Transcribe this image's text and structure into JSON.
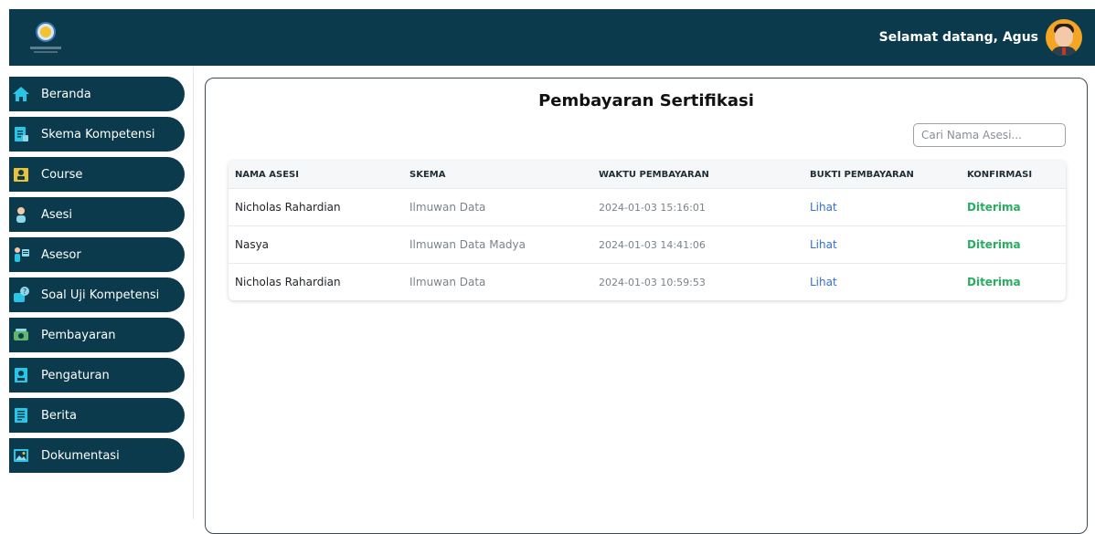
{
  "header": {
    "welcome": "Selamat datang, Agus"
  },
  "sidebar": {
    "items": [
      {
        "label": "Beranda",
        "icon": "home-icon"
      },
      {
        "label": "Skema Kompetensi",
        "icon": "document-icon"
      },
      {
        "label": "Course",
        "icon": "course-icon"
      },
      {
        "label": "Asesi",
        "icon": "user-icon"
      },
      {
        "label": "Asesor",
        "icon": "assessor-icon"
      },
      {
        "label": "Soal Uji Kompetensi",
        "icon": "question-icon"
      },
      {
        "label": "Pembayaran",
        "icon": "payment-icon"
      },
      {
        "label": "Pengaturan",
        "icon": "settings-icon"
      },
      {
        "label": "Berita",
        "icon": "news-icon"
      },
      {
        "label": "Dokumentasi",
        "icon": "image-icon"
      }
    ]
  },
  "main": {
    "title": "Pembayaran Sertifikasi",
    "search_placeholder": "Cari Nama Asesi...",
    "columns": [
      "NAMA ASESI",
      "SKEMA",
      "WAKTU PEMBAYARAN",
      "BUKTI PEMBAYARAN",
      "KONFIRMASI"
    ],
    "rows": [
      {
        "nama": "Nicholas Rahardian",
        "skema": "Ilmuwan Data",
        "waktu": "2024-01-03 15:16:01",
        "bukti": "Lihat",
        "konfirmasi": "Diterima"
      },
      {
        "nama": "Nasya",
        "skema": "Ilmuwan Data Madya",
        "waktu": "2024-01-03 14:41:06",
        "bukti": "Lihat",
        "konfirmasi": "Diterima"
      },
      {
        "nama": "Nicholas Rahardian",
        "skema": "Ilmuwan Data",
        "waktu": "2024-01-03 10:59:53",
        "bukti": "Lihat",
        "konfirmasi": "Diterima"
      }
    ]
  },
  "colors": {
    "primary": "#0b3a4d",
    "link": "#2f6fd6",
    "success": "#27ae60",
    "accent": "#f5a524"
  }
}
